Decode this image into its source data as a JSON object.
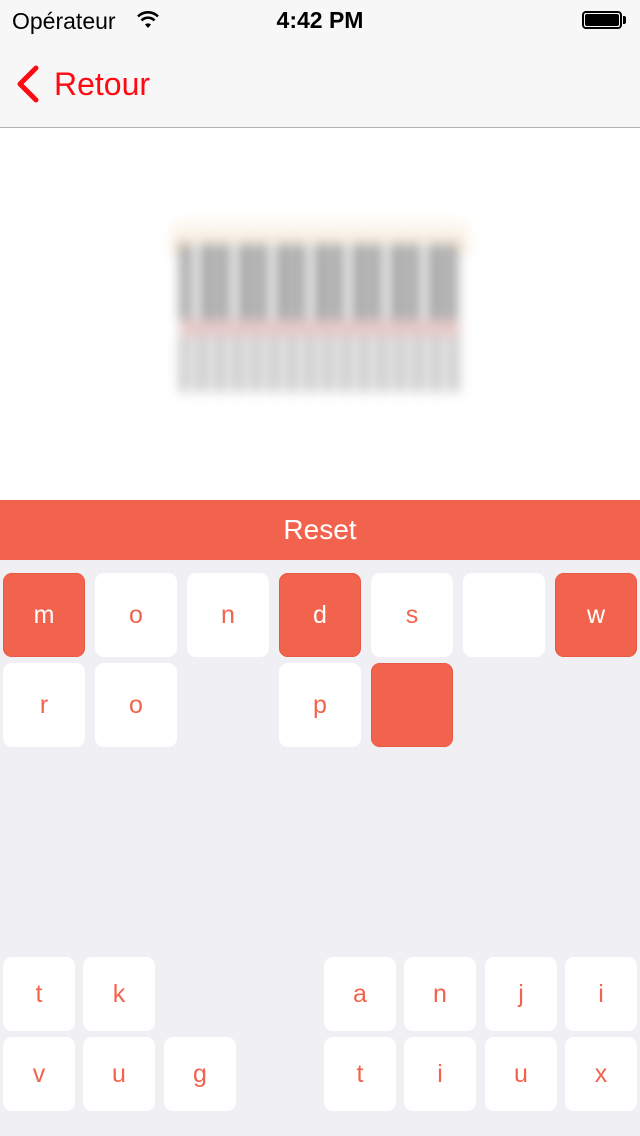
{
  "status_bar": {
    "carrier": "Opérateur",
    "time": "4:42 PM"
  },
  "nav": {
    "back_label": "Retour"
  },
  "reset_label": "Reset",
  "colors": {
    "accent": "#f2634d",
    "back": "#ff0a12",
    "background": "#efeff4"
  },
  "answer": {
    "row1": [
      {
        "letter": "m",
        "filled": true
      },
      {
        "letter": "o",
        "filled": false
      },
      {
        "letter": "n",
        "filled": false
      },
      {
        "letter": "d",
        "filled": true
      },
      {
        "letter": "s",
        "filled": false
      },
      {
        "letter": "",
        "filled": false
      },
      {
        "letter": "w",
        "filled": true
      }
    ],
    "row2": [
      {
        "letter": "r",
        "filled": false
      },
      {
        "letter": "o",
        "filled": false
      },
      {
        "letter": "p",
        "filled": false
      },
      {
        "letter": "",
        "filled": true
      }
    ]
  },
  "keyboard": {
    "row1": [
      "t",
      "k",
      "a",
      "n",
      "j",
      "i"
    ],
    "row2": [
      "v",
      "u",
      "g",
      "t",
      "i",
      "u",
      "x"
    ]
  }
}
